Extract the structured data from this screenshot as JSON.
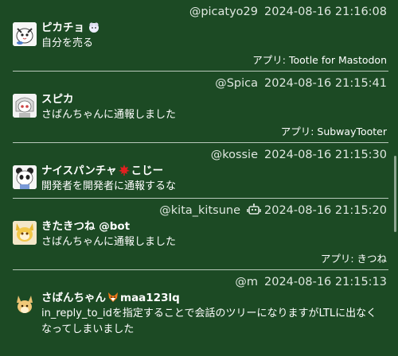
{
  "statuses": [
    {
      "acct": "@picatyo29",
      "time": "2024-08-16 21:16:08",
      "name": "ピカチョ",
      "name_emoji": "sheep-emoji",
      "text": "自分を売る",
      "via": "アプリ: Tootle for Mastodon"
    },
    {
      "acct": "@Spica",
      "time": "2024-08-16 21:15:41",
      "name": "スピカ",
      "text": "さばんちゃんに通報しました",
      "via": "アプリ: SubwayTooter"
    },
    {
      "acct": "@kossie",
      "time": "2024-08-16 21:15:30",
      "name_before": "ナイスパンチャ",
      "name_emoji": "red-maple-leaf-emoji",
      "name_after": "こじー",
      "text": "開発者を開発者に通報するな"
    },
    {
      "acct": "@kita_kitsune",
      "bot_icon": "robot-icon",
      "time": "2024-08-16 21:15:20",
      "name": "きたきつね @bot",
      "text": "さばんちゃんに通報しました",
      "via": "アプリ: きつね"
    },
    {
      "acct": "@m",
      "time": "2024-08-16 21:15:13",
      "name_before": "さばんちゃん",
      "name_emoji": "fox-emoji",
      "name_after": "maa123lq",
      "text": "in_reply_to_idを指定することで会話のツリーになりますがLTLに出なくなってしまいました"
    }
  ],
  "colors": {
    "background": "#1c4a24",
    "divider": "#b9c9bc",
    "meta_text": "#dfe7e0"
  }
}
